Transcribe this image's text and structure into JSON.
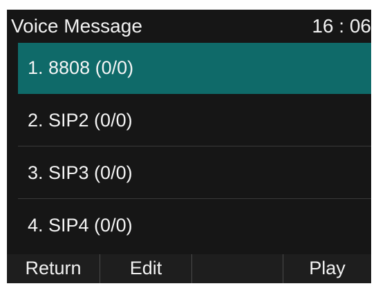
{
  "header": {
    "title": "Voice Message",
    "time": "16 : 06"
  },
  "list": {
    "items": [
      {
        "label": "1.  8808  (0/0)",
        "selected": true
      },
      {
        "label": "2.  SIP2  (0/0)",
        "selected": false
      },
      {
        "label": "3.  SIP3  (0/0)",
        "selected": false
      },
      {
        "label": "4.  SIP4  (0/0)",
        "selected": false
      }
    ]
  },
  "softkeys": [
    "Return",
    "Edit",
    "",
    "Play"
  ],
  "colors": {
    "background": "#161616",
    "selection": "#0f6a69",
    "text": "#f2f2f2",
    "softkey_bar": "#1e1e1e"
  }
}
